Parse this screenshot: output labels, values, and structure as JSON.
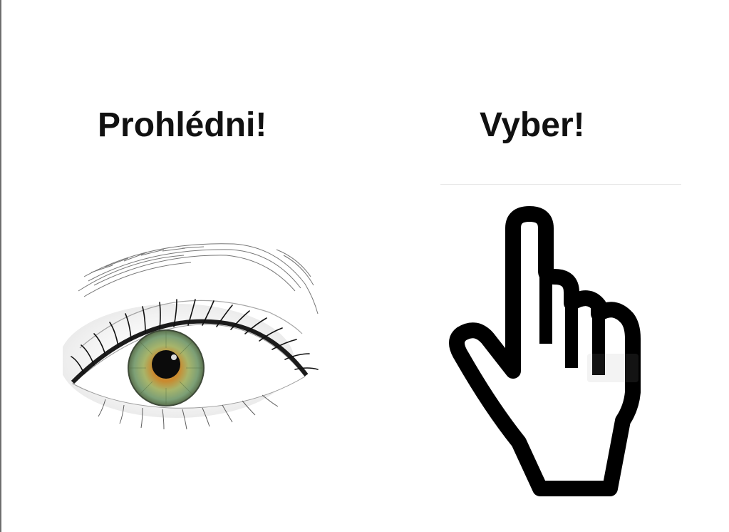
{
  "headings": {
    "left": "Prohlédni!",
    "right": "Vyber!"
  },
  "icons": {
    "left": "eye-icon",
    "right": "pointing-hand-cursor-icon"
  },
  "colors": {
    "background": "#ffffff",
    "text": "#111111",
    "iris_outer": "#6e8f5a",
    "iris_inner": "#c9892e",
    "hand_outline": "#000000"
  }
}
